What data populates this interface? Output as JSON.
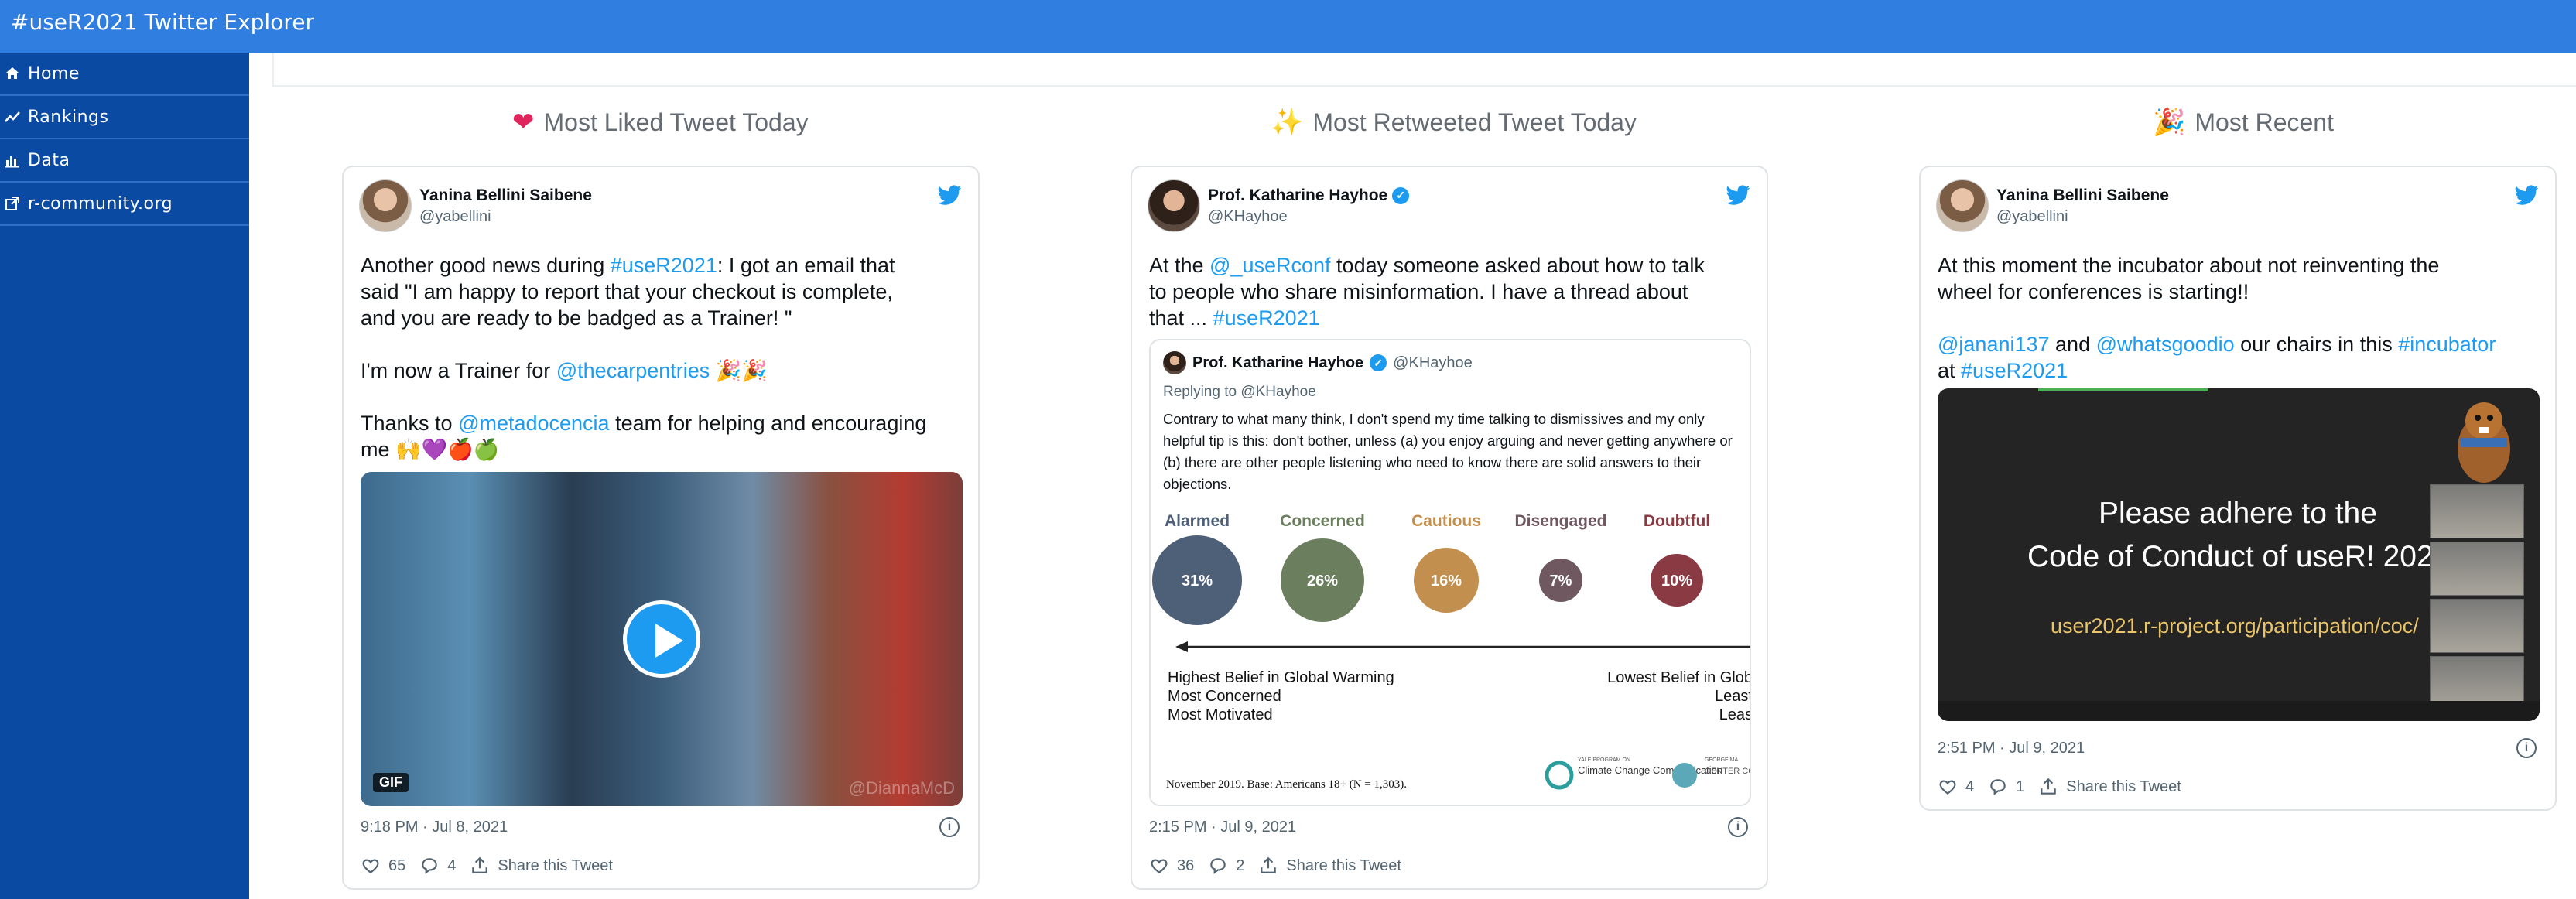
{
  "app": {
    "title": "#useR2021 Twitter Explorer"
  },
  "sidebar": {
    "items": [
      {
        "label": "Home",
        "icon": "home-icon"
      },
      {
        "label": "Rankings",
        "icon": "trend-icon"
      },
      {
        "label": "Data",
        "icon": "bar-chart-icon"
      },
      {
        "label": "r-community.org",
        "icon": "external-link-icon"
      }
    ]
  },
  "columns": {
    "liked": {
      "title": "Most Liked Tweet Today",
      "icon": "heart-icon"
    },
    "retweeted": {
      "title": "Most Retweeted Tweet Today",
      "icon": "sparkles-icon"
    },
    "recent": {
      "title": "Most Recent",
      "icon": "party-popper-icon"
    }
  },
  "tweets": {
    "liked": {
      "name": "Yanina Bellini Saibene",
      "handle": "@yabellini",
      "p1_a": "Another good news during ",
      "p1_tag": "#useR2021",
      "p1_b": ": I got an email that",
      "p1_line2": "said \"I am happy to report that your checkout is complete,",
      "p1_line3": "and you are ready to be badged as a Trainer! \"",
      "p2_a": "I'm now a Trainer for ",
      "p2_mention": "@thecarpentries",
      "p2_emoji": "🎉🎉",
      "p3_a": "Thanks to ",
      "p3_mention": "@metadocencia",
      "p3_b": " team for helping and encouraging",
      "p3_line2": "me 🙌💜🍎🍏",
      "gif_label": "GIF",
      "watermark": "@DiannaMcD",
      "time": "9:18 PM · Jul 8, 2021",
      "likes": "65",
      "replies": "4",
      "share": "Share this Tweet"
    },
    "retweeted": {
      "name": "Prof. Katharine Hayhoe",
      "handle": "@KHayhoe",
      "l1_a": "At the ",
      "l1_mention": "@_useRconf",
      "l1_b": " today someone asked about how to talk",
      "l2": "to people who share misinformation. I have a thread about",
      "l3_a": "that ... ",
      "l3_tag": "#useR2021",
      "quote": {
        "name": "Prof. Katharine Hayhoe",
        "handle": "@KHayhoe",
        "replying": "Replying to @KHayhoe",
        "text": "Contrary to what many think, I don't spend my time talking to dismissives and my only helpful tip is this: don't bother, unless (a) you enjoy arguing and never getting anywhere or (b) there are other people listening who need to know there are solid answers to their objections.",
        "categories": [
          {
            "label": "Alarmed",
            "value": "31%",
            "color": "#4e5f78"
          },
          {
            "label": "Concerned",
            "value": "26%",
            "color": "#6b7f5f"
          },
          {
            "label": "Cautious",
            "value": "16%",
            "color": "#c28f4e"
          },
          {
            "label": "Disengaged",
            "value": "7%",
            "color": "#6f5860"
          },
          {
            "label": "Doubtful",
            "value": "10%",
            "color": "#8a3a43"
          }
        ],
        "left_lines": [
          "Highest Belief in Global Warming",
          "Most Concerned",
          "Most Motivated"
        ],
        "right_lines": [
          "Lowest Belief in Glob",
          "Least",
          "Leas"
        ],
        "footnote": "November 2019. Base: Americans 18+ (N = 1,303).",
        "logo1": "Climate Change Communication",
        "logo1_small": "YALE PROGRAM ON",
        "logo2": "CENTER COMMU",
        "logo2_small": "GEORGE MA"
      },
      "time": "2:15 PM · Jul 9, 2021",
      "likes": "36",
      "replies": "2",
      "share": "Share this Tweet"
    },
    "recent": {
      "name": "Yanina Bellini Saibene",
      "handle": "@yabellini",
      "l1": "At this moment the incubator about not reinventing the",
      "l2": "wheel for conferences is starting!!",
      "l3_m1": "@janani137",
      "l3_and": " and ",
      "l3_m2": "@whatsgoodio",
      "l3_mid": " our chairs in this ",
      "l3_tag": "#incubator",
      "l4_a": "at ",
      "l4_tag": "#useR2021",
      "slide_line1": "Please adhere to the",
      "slide_line2": "Code of Conduct of useR! 202",
      "slide_url": "user2021.r-project.org/participation/coc/",
      "time": "2:51 PM · Jul 9, 2021",
      "likes": "4",
      "replies": "1",
      "share": "Share this Tweet"
    }
  },
  "colors": {
    "topbar": "#2f7ee0",
    "sidebar": "#0b4aa2",
    "link": "#1d9bf0"
  }
}
